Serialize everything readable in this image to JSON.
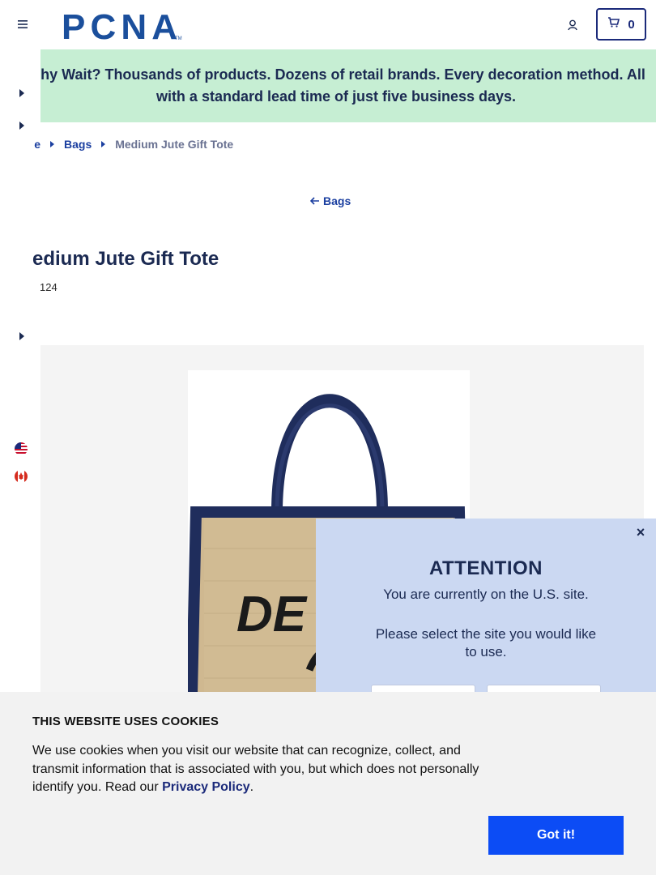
{
  "header": {
    "logo_text": "PCNA",
    "cart_count": "0"
  },
  "banner": {
    "text": "Why Wait? Thousands of products. Dozens of retail brands. Every decoration method. All with a standard lead time of just five business days."
  },
  "breadcrumb": {
    "home": "Home",
    "category": "Bags",
    "current": "Medium Jute Gift Tote"
  },
  "back_link": "Bags",
  "product": {
    "title": "Medium Jute Gift Tote",
    "sku": "124"
  },
  "attention_modal": {
    "close": "×",
    "title": "ATTENTION",
    "line1": "You are currently on the U.S. site.",
    "line2": "Please select the site you would like to use."
  },
  "cookie_banner": {
    "title": "THIS WEBSITE USES COOKIES",
    "body": "We use cookies when you visit our website that can recognize, collect, and transmit information that is associated with you, but which does not personally identify you. Read our ",
    "link": "Privacy Policy",
    "period": ".",
    "button": "Got it!"
  },
  "colors": {
    "brand_navy": "#1b2a7a",
    "banner_green": "#c6eed3",
    "modal_blue": "#cbd8f2",
    "cookie_button": "#0c4cf5"
  },
  "icons": [
    "menu-icon",
    "user-icon",
    "cart-icon",
    "caret-right-icon",
    "arrow-left-icon",
    "us-flag-icon",
    "canada-flag-icon",
    "close-icon"
  ]
}
